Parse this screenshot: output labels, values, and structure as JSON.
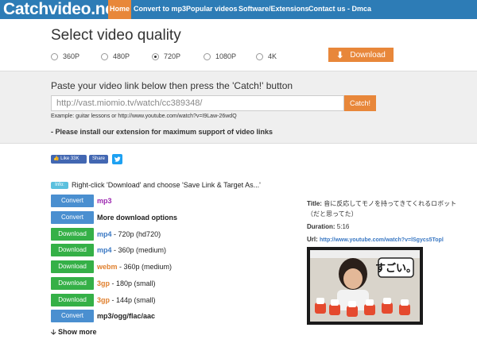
{
  "nav": {
    "logo": "Catchvideo.net",
    "items": [
      "Home",
      "Convert to mp3",
      "Popular videos",
      "Software/Extensions",
      "Contact us - Dmca"
    ]
  },
  "quality": {
    "title": "Select video quality",
    "options": [
      "360P",
      "480P",
      "720P",
      "1080P",
      "4K"
    ],
    "selected": "720P",
    "download_label": "Download"
  },
  "paste": {
    "instruction": "Paste your video link below then press the 'Catch!' button",
    "input_value": "http://vast.miomio.tv/watch/cc389348/",
    "catch_label": "Catch!",
    "example": "Example: guitar lessons or http://www.youtube.com/watch?v=I9Law-26wdQ",
    "install_note": "- Please install our extension for maximum support of video links"
  },
  "social": {
    "like_label": "Like 33K",
    "share_label": "Share"
  },
  "info": {
    "badge": "Info:",
    "text": "Right-click 'Download' and choose 'Save Link & Target As...'"
  },
  "rows": [
    {
      "button": "Convert",
      "kind": "convert",
      "format": "mp3",
      "detail": ""
    },
    {
      "button": "Convert",
      "kind": "convert",
      "format": "More download options",
      "detail": ""
    },
    {
      "button": "Download",
      "kind": "download",
      "format": "mp4",
      "detail": "- 720p   (hd720)"
    },
    {
      "button": "Download",
      "kind": "download",
      "format": "mp4",
      "detail": "- 360p   (medium)"
    },
    {
      "button": "Download",
      "kind": "download",
      "format": "webm",
      "detail": "- 360p   (medium)"
    },
    {
      "button": "Download",
      "kind": "download",
      "format": "3gp",
      "detail": "- 180p   (small)"
    },
    {
      "button": "Download",
      "kind": "download",
      "format": "3gp",
      "detail": "- 144p   (small)"
    },
    {
      "button": "Convert",
      "kind": "convert",
      "format": "mp3/ogg/flac/aac",
      "detail": ""
    }
  ],
  "show_more": "Show more",
  "video": {
    "title_label": "Title:",
    "title": "音に反応してモノを持ってきてくれるロボット",
    "title_line2": "（だと思ってた）",
    "duration_label": "Duration:",
    "duration": "5:16",
    "url_label": "Url:",
    "url": "http://www.youtube.com/watch?v=lSgycs5Topl",
    "thumb_caption": "すごい。"
  },
  "colors": {
    "nav_bg": "#2d7cb6",
    "accent_orange": "#e8873a",
    "convert_blue": "#4a8fd0",
    "download_green": "#35b047"
  }
}
